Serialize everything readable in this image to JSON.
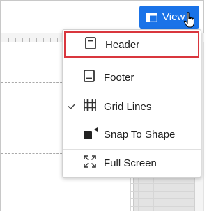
{
  "toolbar": {
    "view_button_label": "View",
    "view_icon": "layout-icon",
    "accent_color": "#1a73e8"
  },
  "view_menu": {
    "items": [
      {
        "label": "Header",
        "icon": "header-icon",
        "checked": false,
        "highlighted": true
      },
      {
        "label": "Footer",
        "icon": "footer-icon",
        "checked": false,
        "highlighted": false
      },
      {
        "label": "Grid Lines",
        "icon": "grid-lines-icon",
        "checked": true,
        "highlighted": false
      },
      {
        "label": "Snap To Shape",
        "icon": "snap-to-shape-icon",
        "checked": false,
        "highlighted": false
      },
      {
        "label": "Full Screen",
        "icon": "full-screen-icon",
        "checked": false,
        "highlighted": false
      }
    ],
    "highlight_color": "#d9363e"
  }
}
